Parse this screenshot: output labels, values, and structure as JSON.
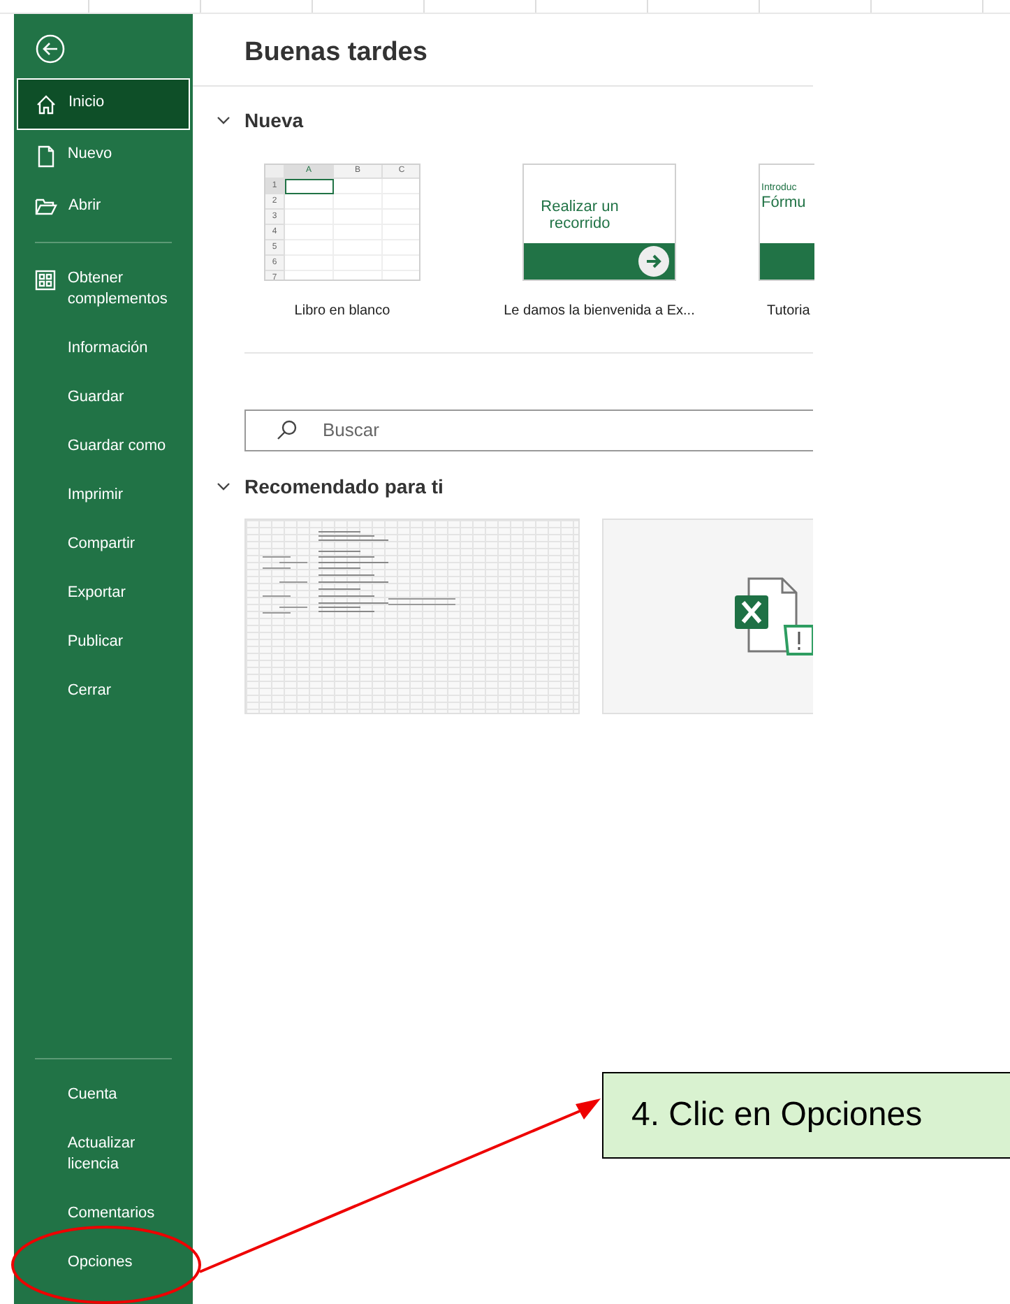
{
  "sidebar": {
    "top_items": [
      {
        "label": "Inicio",
        "selected": true
      },
      {
        "label": "Nuevo",
        "selected": false
      },
      {
        "label": "Abrir",
        "selected": false
      }
    ],
    "middle_items": [
      {
        "label": "Obtener complementos",
        "selected": false
      },
      {
        "label": "Información",
        "selected": false
      },
      {
        "label": "Guardar",
        "selected": false
      },
      {
        "label": "Guardar como",
        "selected": false
      },
      {
        "label": "Imprimir",
        "selected": false
      },
      {
        "label": "Compartir",
        "selected": false
      },
      {
        "label": "Exportar",
        "selected": false
      },
      {
        "label": "Publicar",
        "selected": false
      },
      {
        "label": "Cerrar",
        "selected": false
      }
    ],
    "bottom_items": [
      {
        "label": "Cuenta",
        "selected": false
      },
      {
        "label": "Actualizar licencia",
        "selected": false
      },
      {
        "label": "Comentarios",
        "selected": false
      },
      {
        "label": "Opciones",
        "selected": false
      }
    ]
  },
  "greeting": "Buenas tardes",
  "new_section": {
    "title": "Nueva",
    "expanded": true,
    "templates": [
      {
        "kind": "blank",
        "label": "Libro en blanco",
        "columns": [
          "A",
          "B",
          "C"
        ],
        "rows": [
          "1",
          "2",
          "3",
          "4",
          "5",
          "6",
          "7"
        ]
      },
      {
        "kind": "tour",
        "label": "Le damos la bienvenida a Ex...",
        "heading": "Realizar un recorrido"
      },
      {
        "kind": "tutorial",
        "label": "Tutoria",
        "overline": "Introduc",
        "heading": "Fórmu"
      }
    ]
  },
  "search": {
    "placeholder": "Buscar"
  },
  "recommended": {
    "title": "Recomendado para ti",
    "expanded": true,
    "files": [
      {
        "kind": "sheet"
      },
      {
        "kind": "excel"
      }
    ]
  },
  "callout": {
    "text": "4. Clic en Opciones"
  }
}
